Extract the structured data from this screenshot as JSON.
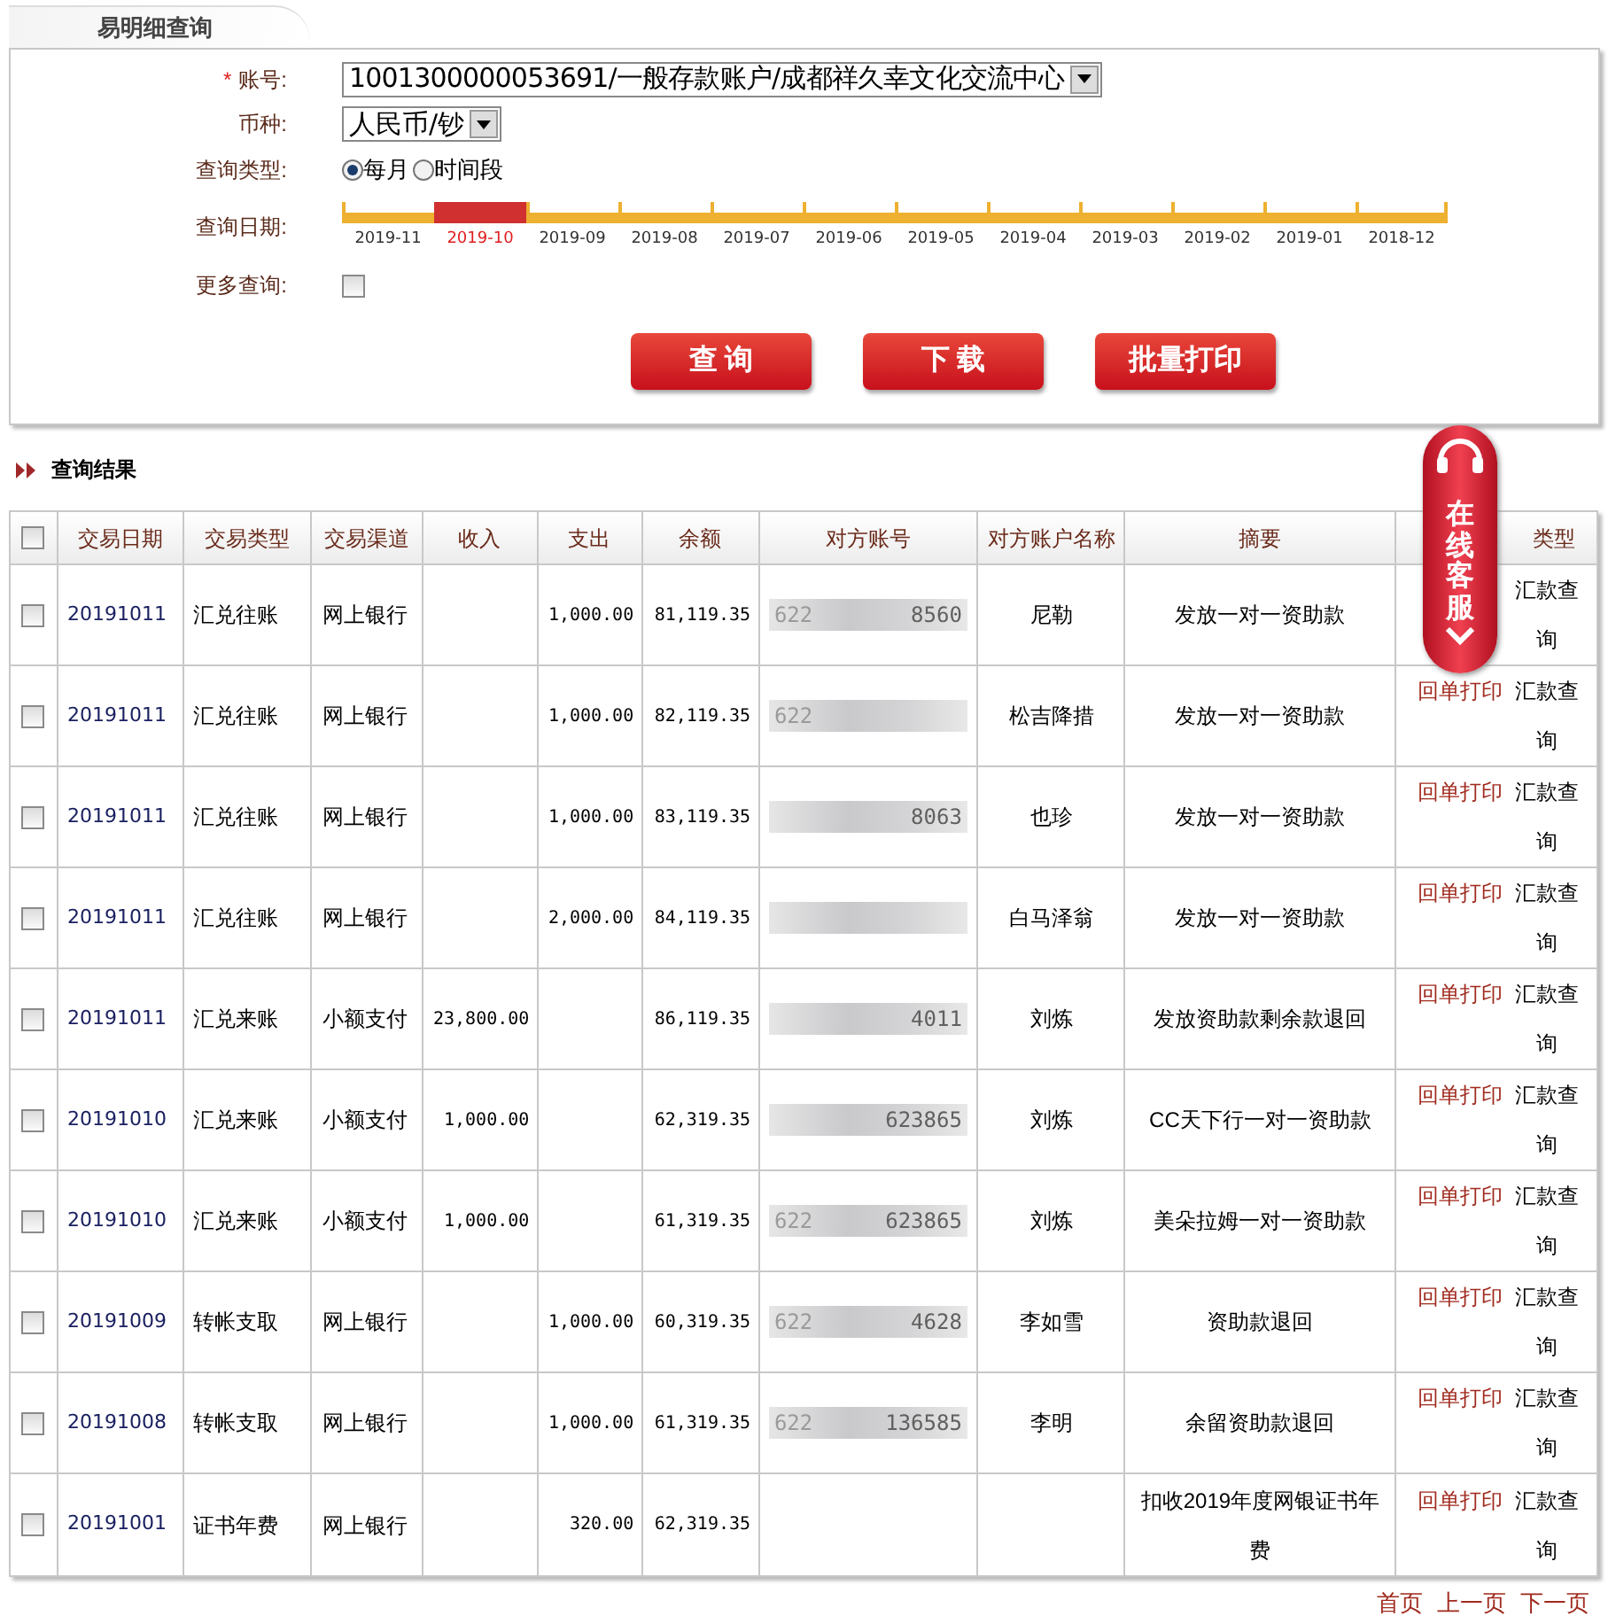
{
  "panel_tab": {
    "title": "易明细查询"
  },
  "form": {
    "account": {
      "label": "账号:",
      "required_mark": "*",
      "value": "1001300000053691/一般存款账户/成都祥久幸文化交流中心"
    },
    "currency": {
      "label": "币种:",
      "value": "人民币/钞"
    },
    "query_type": {
      "label": "查询类型:",
      "options": [
        {
          "label": "每月",
          "selected": true
        },
        {
          "label": "时间段",
          "selected": false
        }
      ]
    },
    "query_date": {
      "label": "查询日期:",
      "months": [
        {
          "label": "2019-11",
          "selected": false
        },
        {
          "label": "2019-10",
          "selected": true
        },
        {
          "label": "2019-09",
          "selected": false
        },
        {
          "label": "2019-08",
          "selected": false
        },
        {
          "label": "2019-07",
          "selected": false
        },
        {
          "label": "2019-06",
          "selected": false
        },
        {
          "label": "2019-05",
          "selected": false
        },
        {
          "label": "2019-04",
          "selected": false
        },
        {
          "label": "2019-03",
          "selected": false
        },
        {
          "label": "2019-02",
          "selected": false
        },
        {
          "label": "2019-01",
          "selected": false
        },
        {
          "label": "2018-12",
          "selected": false
        }
      ]
    },
    "more_query": {
      "label": "更多查询:",
      "checked": false
    },
    "buttons": [
      "查 询",
      "下 载",
      "批量打印"
    ]
  },
  "results": {
    "title": "查询结果",
    "select_all_checked": false,
    "columns": [
      "交易日期",
      "交易类型",
      "交易渠道",
      "收入",
      "支出",
      "余额",
      "对方账号",
      "对方账户名称",
      "摘要",
      "类型"
    ],
    "rows": [
      {
        "checked": false,
        "date": "20191011",
        "type": "汇兑往账",
        "channel": "网上银行",
        "income": "",
        "expense": "1,000.00",
        "balance": "81,119.35",
        "account_start": "622",
        "account_end": "8560",
        "name": "尼勒",
        "summary": "发放一对一资助款",
        "receipt": "",
        "query": "汇款查询"
      },
      {
        "checked": false,
        "date": "20191011",
        "type": "汇兑往账",
        "channel": "网上银行",
        "income": "",
        "expense": "1,000.00",
        "balance": "82,119.35",
        "account_start": "622",
        "account_end": "",
        "name": "松吉降措",
        "summary": "发放一对一资助款",
        "receipt": "回单打印",
        "query": "汇款查询"
      },
      {
        "checked": false,
        "date": "20191011",
        "type": "汇兑往账",
        "channel": "网上银行",
        "income": "",
        "expense": "1,000.00",
        "balance": "83,119.35",
        "account_start": "",
        "account_end": "8063",
        "name": "也珍",
        "summary": "发放一对一资助款",
        "receipt": "回单打印",
        "query": "汇款查询"
      },
      {
        "checked": false,
        "date": "20191011",
        "type": "汇兑往账",
        "channel": "网上银行",
        "income": "",
        "expense": "2,000.00",
        "balance": "84,119.35",
        "account_start": "",
        "account_end": "",
        "name": "白马泽翁",
        "summary": "发放一对一资助款",
        "receipt": "回单打印",
        "query": "汇款查询"
      },
      {
        "checked": false,
        "date": "20191011",
        "type": "汇兑来账",
        "channel": "小额支付",
        "income": "23,800.00",
        "expense": "",
        "balance": "86,119.35",
        "account_start": "",
        "account_end": "4011",
        "name": "刘炼",
        "summary": "发放资助款剩余款退回",
        "receipt": "回单打印",
        "query": "汇款查询"
      },
      {
        "checked": false,
        "date": "20191010",
        "type": "汇兑来账",
        "channel": "小额支付",
        "income": "1,000.00",
        "expense": "",
        "balance": "62,319.35",
        "account_start": "",
        "account_end": "623865",
        "name": "刘炼",
        "summary": "CC天下行一对一资助款",
        "receipt": "回单打印",
        "query": "汇款查询"
      },
      {
        "checked": false,
        "date": "20191010",
        "type": "汇兑来账",
        "channel": "小额支付",
        "income": "1,000.00",
        "expense": "",
        "balance": "61,319.35",
        "account_start": "622",
        "account_end": "623865",
        "name": "刘炼",
        "summary": "美朵拉姆一对一资助款",
        "receipt": "回单打印",
        "query": "汇款查询"
      },
      {
        "checked": false,
        "date": "20191009",
        "type": "转帐支取",
        "channel": "网上银行",
        "income": "",
        "expense": "1,000.00",
        "balance": "60,319.35",
        "account_start": "622",
        "account_end": "4628",
        "name": "李如雪",
        "summary": "资助款退回",
        "receipt": "回单打印",
        "query": "汇款查询"
      },
      {
        "checked": false,
        "date": "20191008",
        "type": "转帐支取",
        "channel": "网上银行",
        "income": "",
        "expense": "1,000.00",
        "balance": "61,319.35",
        "account_start": "622",
        "account_end": "136585",
        "name": "李明",
        "summary": "余留资助款退回",
        "receipt": "回单打印",
        "query": "汇款查询"
      },
      {
        "checked": false,
        "date": "20191001",
        "type": "证书年费",
        "channel": "网上银行",
        "income": "",
        "expense": "320.00",
        "balance": "62,319.35",
        "account_start": "",
        "account_end": "",
        "name": "",
        "summary": "扣收2019年度网银证书年费",
        "receipt": "回单打印",
        "query": "汇款查询"
      }
    ]
  },
  "service_widget": {
    "label": "在线客服"
  },
  "pagination": [
    "首页",
    "上一页",
    "下一页"
  ]
}
